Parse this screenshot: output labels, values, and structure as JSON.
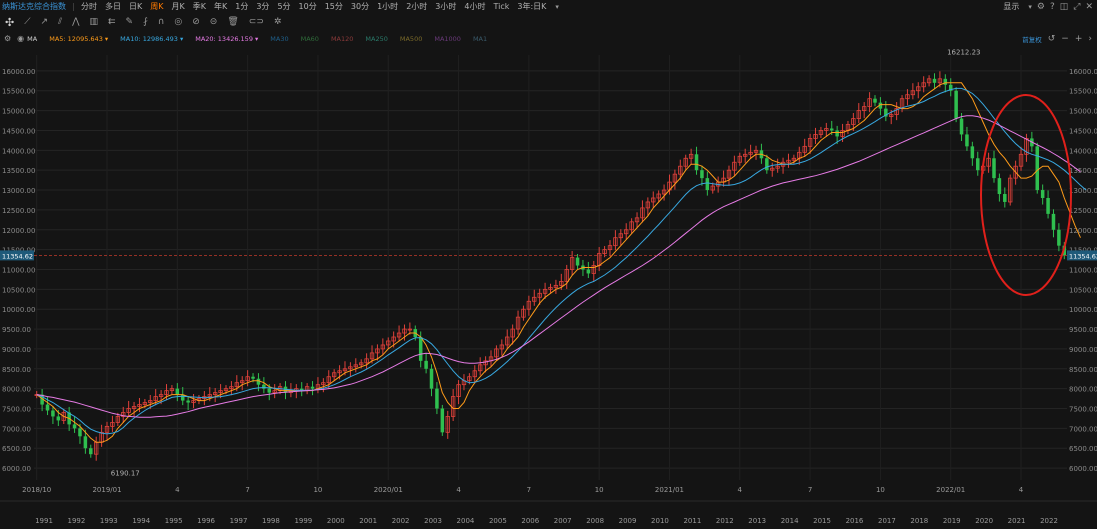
{
  "toolbar": {
    "title": "纳斯达克综合指数",
    "timeframes": [
      {
        "label": "分时",
        "active": false
      },
      {
        "label": "多日",
        "active": false
      },
      {
        "label": "日K",
        "active": false
      },
      {
        "label": "周K",
        "active": true
      },
      {
        "label": "月K",
        "active": false
      },
      {
        "label": "季K",
        "active": false
      },
      {
        "label": "年K",
        "active": false
      },
      {
        "label": "1分",
        "active": false
      },
      {
        "label": "3分",
        "active": false
      },
      {
        "label": "5分",
        "active": false
      },
      {
        "label": "10分",
        "active": false
      },
      {
        "label": "15分",
        "active": false
      },
      {
        "label": "30分",
        "active": false
      },
      {
        "label": "1小时",
        "active": false
      },
      {
        "label": "2小时",
        "active": false
      },
      {
        "label": "3小时",
        "active": false
      },
      {
        "label": "4小时",
        "active": false
      },
      {
        "label": "Tick",
        "active": false
      }
    ],
    "range": "3年:日K",
    "display": "显示",
    "reset": "前复权"
  },
  "legend": {
    "items": [
      {
        "label": "MA",
        "value": "",
        "color": "#d0d0d0"
      },
      {
        "label": "MA5:",
        "value": "12095.643",
        "color": "#ff9c1a"
      },
      {
        "label": "MA10:",
        "value": "12986.493",
        "color": "#38a8e0"
      },
      {
        "label": "MA20:",
        "value": "13426.159",
        "color": "#e67be5"
      },
      {
        "label": "MA30",
        "value": "",
        "color": "#1f5f8a"
      },
      {
        "label": "MA60",
        "value": "",
        "color": "#2f6b3a"
      },
      {
        "label": "MA120",
        "value": "",
        "color": "#8a3a3a"
      },
      {
        "label": "MA250",
        "value": "",
        "color": "#2a7a6a"
      },
      {
        "label": "MA500",
        "value": "",
        "color": "#7a6a2a"
      },
      {
        "label": "MA1000",
        "value": "",
        "color": "#6a3a7a"
      },
      {
        "label": "MA1",
        "value": "",
        "color": "#3a5a6a"
      }
    ]
  },
  "chart_data": {
    "type": "candlestick",
    "ylim": [
      5700,
      16400
    ],
    "y_ticks": [
      6000,
      6500,
      7000,
      7500,
      8000,
      8500,
      9000,
      9500,
      10000,
      10500,
      11000,
      11500,
      12000,
      12500,
      13000,
      13500,
      14000,
      14500,
      15000,
      15500,
      16000
    ],
    "y_tick_labels": [
      "6000.00",
      "6500.00",
      "7000.00",
      "7500.00",
      "8000.00",
      "8500.00",
      "9000.00",
      "9500.00",
      "10000.00",
      "10500.00",
      "11000.00",
      "11500.00",
      "12000.00",
      "12500.00",
      "13000.00",
      "13500.00",
      "14000.00",
      "14500.00",
      "15000.00",
      "15500.00",
      "16000.00"
    ],
    "x_labels": [
      "2018/10",
      "2019/01",
      "4",
      "7",
      "10",
      "2020/01",
      "4",
      "7",
      "10",
      "2021/01",
      "4",
      "7",
      "10",
      "2022/01",
      "4"
    ],
    "x_label_slots": [
      0,
      13,
      26,
      39,
      52,
      65,
      78,
      91,
      104,
      117,
      130,
      143,
      156,
      169,
      182
    ],
    "year_labels": [
      "1991",
      "1992",
      "1993",
      "1994",
      "1995",
      "1996",
      "1997",
      "1998",
      "1999",
      "2000",
      "2001",
      "2002",
      "2003",
      "2004",
      "2005",
      "2006",
      "2007",
      "2008",
      "2009",
      "2010",
      "2011",
      "2012",
      "2013",
      "2014",
      "2015",
      "2016",
      "2017",
      "2018",
      "2019",
      "2020",
      "2021",
      "2022"
    ],
    "last_price": 11354.62,
    "last_price_label": "11354.62",
    "max_label": "16212.23",
    "min_label": "6190.17",
    "closes": [
      7850,
      7600,
      7450,
      7300,
      7200,
      7400,
      7100,
      7000,
      6800,
      6500,
      6350,
      6650,
      6900,
      7050,
      7150,
      7300,
      7400,
      7500,
      7550,
      7600,
      7650,
      7700,
      7800,
      7850,
      7950,
      8000,
      7850,
      7700,
      7650,
      7700,
      7750,
      7800,
      7850,
      7900,
      7950,
      8000,
      8050,
      8150,
      8200,
      8300,
      8250,
      8100,
      8000,
      7900,
      7950,
      8050,
      7900,
      7950,
      8000,
      7950,
      8050,
      8000,
      8100,
      8150,
      8300,
      8400,
      8450,
      8500,
      8550,
      8600,
      8650,
      8750,
      8900,
      9000,
      9100,
      9200,
      9300,
      9400,
      9500,
      9500,
      9300,
      8700,
      8500,
      8000,
      7500,
      6900,
      7300,
      7800,
      8100,
      8200,
      8300,
      8450,
      8600,
      8700,
      8800,
      9000,
      9100,
      9300,
      9500,
      9800,
      10000,
      10200,
      10300,
      10400,
      10500,
      10550,
      10600,
      10700,
      11000,
      11300,
      11100,
      11000,
      10900,
      11100,
      11400,
      11500,
      11600,
      11800,
      11900,
      12000,
      12200,
      12300,
      12550,
      12700,
      12800,
      12900,
      13000,
      13200,
      13400,
      13600,
      13800,
      13900,
      13500,
      13300,
      13000,
      13100,
      13200,
      13300,
      13500,
      13700,
      13850,
      13900,
      13950,
      14000,
      13800,
      13500,
      13550,
      13600,
      13700,
      13750,
      13800,
      13950,
      14100,
      14300,
      14400,
      14500,
      14550,
      14500,
      14350,
      14500,
      14650,
      14800,
      15000,
      15100,
      15300,
      15200,
      15050,
      14850,
      14900,
      15050,
      15300,
      15400,
      15500,
      15600,
      15700,
      15800,
      15700,
      15800,
      15650,
      15500,
      14800,
      14400,
      14100,
      13800,
      13500,
      13600,
      13800,
      13300,
      12900,
      12700,
      13300,
      13600,
      13900,
      14300,
      14100,
      13000,
      12800,
      12400,
      12000,
      11600,
      11350
    ],
    "ma5": [
      7850,
      7750,
      7650,
      7550,
      7400,
      7300,
      7250,
      7150,
      7050,
      6900,
      6750,
      6650,
      6650,
      6700,
      6800,
      7000,
      7150,
      7300,
      7400,
      7500,
      7550,
      7600,
      7650,
      7700,
      7800,
      7850,
      7850,
      7850,
      7800,
      7750,
      7700,
      7700,
      7750,
      7800,
      7850,
      7900,
      7950,
      8000,
      8100,
      8150,
      8200,
      8200,
      8150,
      8050,
      8000,
      7950,
      7950,
      7950,
      7950,
      7950,
      7950,
      7950,
      8000,
      8050,
      8100,
      8200,
      8300,
      8400,
      8450,
      8500,
      8550,
      8600,
      8700,
      8750,
      8850,
      9000,
      9100,
      9200,
      9300,
      9400,
      9400,
      9300,
      9100,
      8800,
      8400,
      7900,
      7650,
      7500,
      7500,
      7650,
      7950,
      8150,
      8300,
      8450,
      8550,
      8700,
      8800,
      9000,
      9150,
      9300,
      9550,
      9750,
      9950,
      10150,
      10300,
      10400,
      10500,
      10550,
      10650,
      10850,
      11000,
      11050,
      11050,
      11050,
      11100,
      11200,
      11300,
      11450,
      11600,
      11750,
      11900,
      12050,
      12200,
      12350,
      12550,
      12700,
      12850,
      13000,
      13150,
      13300,
      13500,
      13650,
      13650,
      13600,
      13500,
      13350,
      13200,
      13200,
      13250,
      13350,
      13500,
      13650,
      13800,
      13900,
      13900,
      13850,
      13750,
      13700,
      13650,
      13650,
      13700,
      13800,
      13850,
      13950,
      14100,
      14250,
      14350,
      14450,
      14450,
      14450,
      14500,
      14550,
      14650,
      14750,
      14900,
      15050,
      15150,
      15150,
      15150,
      15100,
      15050,
      15050,
      15100,
      15200,
      15350,
      15450,
      15550,
      15650,
      15700,
      15700,
      15700,
      15700,
      15500,
      15300,
      15000,
      14700,
      14400,
      14150,
      13950,
      13800,
      13600,
      13450,
      13300,
      13300,
      13350,
      13500,
      13600,
      13600,
      13400,
      13200,
      12800,
      12450,
      12100,
      11800
    ],
    "ma10": [
      7850,
      7800,
      7720,
      7650,
      7560,
      7470,
      7380,
      7300,
      7200,
      7080,
      6980,
      6920,
      6880,
      6860,
      6880,
      6920,
      7020,
      7150,
      7260,
      7360,
      7450,
      7530,
      7600,
      7660,
      7720,
      7780,
      7800,
      7810,
      7800,
      7790,
      7780,
      7770,
      7780,
      7790,
      7800,
      7820,
      7850,
      7880,
      7920,
      7960,
      8000,
      8020,
      8030,
      8020,
      8010,
      8000,
      7980,
      7970,
      7960,
      7960,
      7960,
      7960,
      7980,
      8010,
      8050,
      8100,
      8160,
      8230,
      8300,
      8360,
      8420,
      8490,
      8570,
      8660,
      8750,
      8850,
      8940,
      9030,
      9130,
      9220,
      9280,
      9280,
      9230,
      9130,
      8980,
      8800,
      8620,
      8450,
      8300,
      8200,
      8150,
      8160,
      8200,
      8260,
      8340,
      8450,
      8560,
      8680,
      8810,
      8950,
      9100,
      9270,
      9430,
      9590,
      9750,
      9900,
      10040,
      10170,
      10290,
      10400,
      10500,
      10580,
      10650,
      10700,
      10780,
      10860,
      10960,
      11060,
      11180,
      11300,
      11430,
      11560,
      11700,
      11840,
      11990,
      12130,
      12280,
      12430,
      12580,
      12740,
      12890,
      13020,
      13110,
      13160,
      13180,
      13160,
      13140,
      13120,
      13120,
      13140,
      13180,
      13240,
      13320,
      13420,
      13510,
      13580,
      13620,
      13640,
      13650,
      13650,
      13650,
      13680,
      13720,
      13780,
      13860,
      13940,
      14030,
      14120,
      14210,
      14290,
      14360,
      14420,
      14490,
      14560,
      14640,
      14720,
      14810,
      14890,
      14960,
      15020,
      15070,
      15110,
      15140,
      15180,
      15230,
      15300,
      15360,
      15430,
      15480,
      15530,
      15560,
      15560,
      15510,
      15430,
      15310,
      15160,
      14990,
      14810,
      14640,
      14470,
      14310,
      14170,
      14050,
      13960,
      13900,
      13860,
      13810,
      13760,
      13690,
      13600,
      13500,
      13380,
      13250,
      13120,
      13000
    ],
    "ma20": [
      7850,
      7830,
      7800,
      7780,
      7750,
      7720,
      7690,
      7660,
      7620,
      7580,
      7540,
      7500,
      7460,
      7420,
      7380,
      7350,
      7320,
      7300,
      7290,
      7280,
      7280,
      7280,
      7290,
      7300,
      7310,
      7330,
      7360,
      7390,
      7420,
      7460,
      7500,
      7530,
      7560,
      7590,
      7620,
      7650,
      7680,
      7710,
      7740,
      7770,
      7800,
      7820,
      7840,
      7860,
      7880,
      7900,
      7910,
      7920,
      7930,
      7940,
      7950,
      7960,
      7970,
      7980,
      8000,
      8020,
      8050,
      8080,
      8110,
      8150,
      8200,
      8250,
      8300,
      8360,
      8420,
      8490,
      8560,
      8630,
      8700,
      8770,
      8830,
      8870,
      8890,
      8880,
      8860,
      8820,
      8770,
      8720,
      8680,
      8650,
      8640,
      8640,
      8650,
      8670,
      8700,
      8740,
      8790,
      8850,
      8920,
      9000,
      9090,
      9180,
      9280,
      9380,
      9480,
      9580,
      9680,
      9780,
      9880,
      9980,
      10080,
      10180,
      10270,
      10360,
      10450,
      10540,
      10620,
      10700,
      10780,
      10860,
      10940,
      11020,
      11100,
      11190,
      11280,
      11380,
      11480,
      11580,
      11690,
      11800,
      11910,
      12020,
      12130,
      12240,
      12340,
      12430,
      12510,
      12580,
      12640,
      12700,
      12760,
      12820,
      12880,
      12940,
      13000,
      13050,
      13100,
      13140,
      13180,
      13210,
      13240,
      13270,
      13300,
      13330,
      13360,
      13400,
      13440,
      13480,
      13520,
      13570,
      13620,
      13670,
      13720,
      13780,
      13840,
      13900,
      13960,
      14020,
      14080,
      14140,
      14200,
      14260,
      14320,
      14380,
      14440,
      14500,
      14560,
      14620,
      14680,
      14740,
      14800,
      14850,
      14870,
      14870,
      14850,
      14810,
      14760,
      14700,
      14630,
      14560,
      14490,
      14420,
      14350,
      14280,
      14210,
      14140,
      14070,
      14000,
      13920,
      13840,
      13750,
      13660,
      13560,
      13460
    ]
  }
}
